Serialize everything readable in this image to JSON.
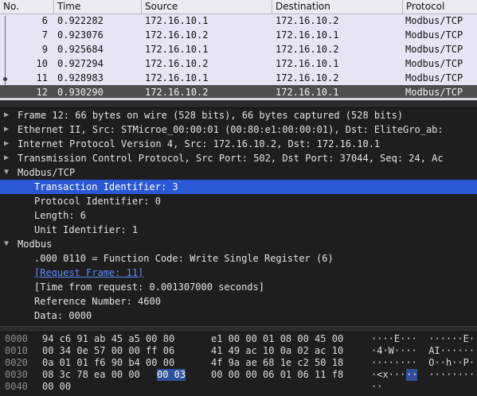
{
  "packet_list": {
    "columns": [
      "No.",
      "Time",
      "Source",
      "Destination",
      "Protocol"
    ],
    "rows": [
      {
        "no": "6",
        "time": "0.922282",
        "source": "172.16.10.1",
        "destination": "172.16.10.2",
        "protocol": "Modbus/TCP"
      },
      {
        "no": "7",
        "time": "0.923076",
        "source": "172.16.10.2",
        "destination": "172.16.10.1",
        "protocol": "Modbus/TCP"
      },
      {
        "no": "9",
        "time": "0.925684",
        "source": "172.16.10.1",
        "destination": "172.16.10.2",
        "protocol": "Modbus/TCP"
      },
      {
        "no": "10",
        "time": "0.927294",
        "source": "172.16.10.2",
        "destination": "172.16.10.1",
        "protocol": "Modbus/TCP"
      },
      {
        "no": "11",
        "time": "0.928983",
        "source": "172.16.10.1",
        "destination": "172.16.10.2",
        "protocol": "Modbus/TCP"
      },
      {
        "no": "12",
        "time": "0.930290",
        "source": "172.16.10.2",
        "destination": "172.16.10.1",
        "protocol": "Modbus/TCP"
      }
    ],
    "selected_row": "12"
  },
  "details": {
    "frame": "Frame 12: 66 bytes on wire (528 bits), 66 bytes captured (528 bits)",
    "ethernet": "Ethernet II, Src: STMicroe_00:00:01 (00:80:e1:00:00:01), Dst: EliteGro_ab:",
    "ip": "Internet Protocol Version 4, Src: 172.16.10.2, Dst: 172.16.10.1",
    "tcp": "Transmission Control Protocol, Src Port: 502, Dst Port: 37044, Seq: 24, Ac",
    "modbus_tcp": {
      "title": "Modbus/TCP",
      "transaction_id": "Transaction Identifier: 3",
      "protocol_id": "Protocol Identifier: 0",
      "length": "Length: 6",
      "unit_id": "Unit Identifier: 1"
    },
    "modbus": {
      "title": "Modbus",
      "function_code": ".000 0110 = Function Code: Write Single Register (6)",
      "request_frame": "[Request Frame: 11]",
      "time_from_request": "[Time from request: 0.001307000 seconds]",
      "reference_number": "Reference Number: 4600",
      "data": "Data: 0000"
    }
  },
  "hex": {
    "rows": [
      {
        "offset": "0000",
        "bytes_a": "94 c6 91 ab 45 a5 00 80",
        "bytes_b": "e1 00 00 01 08 00 45 00",
        "ascii": "····E···  ······E·"
      },
      {
        "offset": "0010",
        "bytes_a": "00 34 0e 57 00 00 ff 06",
        "bytes_b": "41 49 ac 10 0a 02 ac 10",
        "ascii": "·4·W····  AI······"
      },
      {
        "offset": "0020",
        "bytes_a": "0a 01 01 f6 90 b4 00 00",
        "bytes_b": "4f 9a ae 68 1e c2 50 18",
        "ascii": "········  O··h··P·"
      },
      {
        "offset": "0030",
        "bytes_a_pre": "08 3c 78 ea 00 00 ",
        "bytes_a_hl": "00 03",
        "bytes_b": "00 00 00 06 01 06 11 f8",
        "ascii_pre": "·<x···",
        "ascii_hl": "··",
        "ascii_post": "  ········"
      },
      {
        "offset": "0040",
        "bytes_a": "00 00",
        "bytes_b": "",
        "ascii": "··"
      }
    ]
  },
  "colors": {
    "list_bg": "#e7e5f4",
    "selected_row_bg": "#4e4e4e",
    "detail_highlight": "#2b59d6",
    "link": "#5b8df7",
    "byte_highlight": "#2f4f9a"
  }
}
